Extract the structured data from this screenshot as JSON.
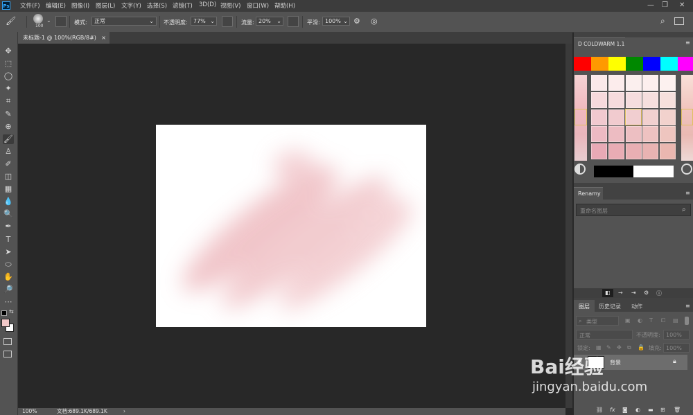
{
  "app": {
    "logo_text": "Ps"
  },
  "menu": [
    "文件(F)",
    "编辑(E)",
    "图像(I)",
    "图层(L)",
    "文字(Y)",
    "选择(S)",
    "滤镜(T)",
    "3D(D)",
    "视图(V)",
    "窗口(W)",
    "帮助(H)"
  ],
  "window_controls": [
    "—",
    "❐",
    "✕"
  ],
  "options": {
    "brush_size": "100",
    "mode_label": "模式:",
    "mode_value": "正常",
    "opacity_label": "不透明度:",
    "opacity_value": "77%",
    "flow_label": "流量:",
    "flow_value": "20%",
    "smoothing_label": "平滑:",
    "smoothing_value": "100%"
  },
  "document_tab": {
    "title": "未标题-1 @ 100%(RGB/8#)",
    "close": "×"
  },
  "status": {
    "zoom": "100%",
    "doc_info": "文档:689.1K/689.1K",
    "arrow": "›"
  },
  "tools": [
    "move-tool",
    "marquee-tool",
    "lasso-tool",
    "magic-wand-tool",
    "crop-tool",
    "eyedropper-tool",
    "healing-tool",
    "brush-tool",
    "stamp-tool",
    "history-brush-tool",
    "eraser-tool",
    "gradient-tool",
    "blur-tool",
    "dodge-tool",
    "pen-tool",
    "type-tool",
    "path-select-tool",
    "shape-tool",
    "hand-tool",
    "zoom-tool",
    "more-tools"
  ],
  "tool_glyphs": [
    "✥",
    "⬚",
    "◯",
    "✦",
    "⌗",
    "✎",
    "⊕",
    "🖌",
    "♙",
    "✐",
    "◫",
    "▦",
    "💧",
    "🔍",
    "✒",
    "T",
    "➤",
    "⬭",
    "✋",
    "🔎",
    "⋯"
  ],
  "colors": {
    "foreground": "#f1c8c8",
    "background": "#ffffff",
    "accent": "#31a8ff"
  },
  "swatches_panel": {
    "title": "D COLDWARM 1.1",
    "colors": [
      "#ff0000",
      "#ff9900",
      "#ffff00",
      "#008800",
      "#0000ff",
      "#00ffff",
      "#ff00ff"
    ],
    "black": "#000000",
    "white": "#ffffff"
  },
  "renamy_panel": {
    "title": "Renamy",
    "placeholder": "重命名图层"
  },
  "layers_panel": {
    "tabs": [
      "图层",
      "历史记录",
      "动作"
    ],
    "filter_label": "类型",
    "blend_mode": "正常",
    "opacity_label": "不透明度:",
    "opacity_value": "100%",
    "lock_label": "锁定:",
    "fill_label": "填充:",
    "fill_value": "100%",
    "layer_name": "背景"
  },
  "watermark": {
    "logo": "Bai经验",
    "url": "jingyan.baidu.com"
  }
}
